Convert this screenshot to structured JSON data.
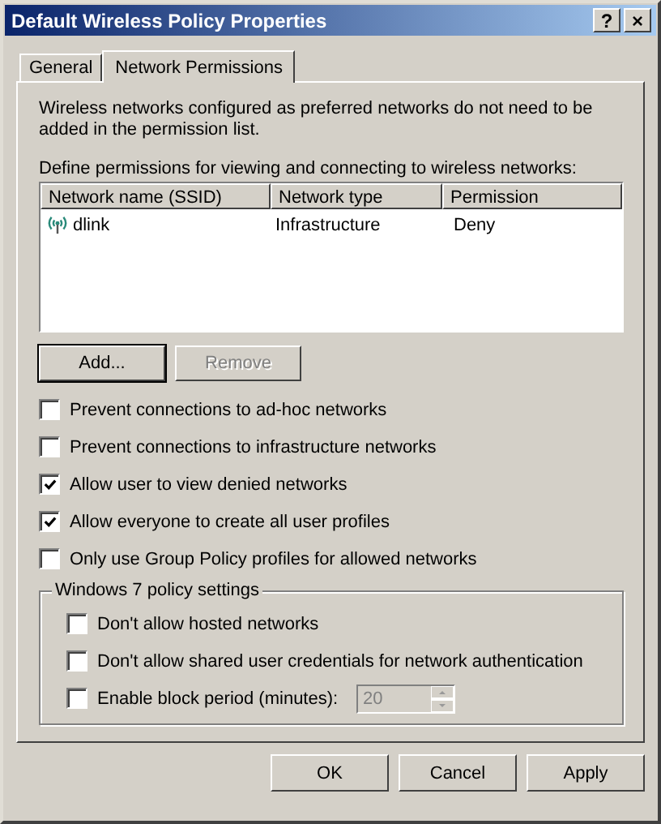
{
  "window": {
    "title": "Default Wireless Policy Properties",
    "help_button": "?",
    "close_button": "×"
  },
  "tabs": [
    {
      "label": "General",
      "selected": false
    },
    {
      "label": "Network Permissions",
      "selected": true
    }
  ],
  "description": "Wireless networks configured as preferred networks do not need to be added in the permission list.",
  "list_label": "Define permissions for viewing and connecting to wireless networks:",
  "table": {
    "columns": [
      "Network name (SSID)",
      "Network type",
      "Permission"
    ],
    "rows": [
      {
        "cells": [
          "dlink",
          "Infrastructure",
          "Deny"
        ]
      }
    ]
  },
  "list_buttons": [
    {
      "label": "Add...",
      "disabled": false
    },
    {
      "label": "Remove",
      "disabled": true
    }
  ],
  "options": [
    {
      "label": "Prevent connections to ad-hoc networks",
      "checked": false
    },
    {
      "label": "Prevent connections to infrastructure networks",
      "checked": false
    },
    {
      "label": "Allow user to view denied networks",
      "checked": true
    },
    {
      "label": "Allow everyone to create all user profiles",
      "checked": true
    },
    {
      "label": "Only use Group Policy profiles for allowed networks",
      "checked": false
    }
  ],
  "group": {
    "title": "Windows 7 policy settings",
    "options": [
      {
        "label": "Don't allow hosted networks",
        "checked": false
      },
      {
        "label": "Don't allow shared user credentials for network authentication",
        "checked": false
      }
    ],
    "block_period": {
      "label": "Enable block period (minutes):",
      "checked": false,
      "value": "20",
      "disabled": true
    }
  },
  "footer_buttons": [
    {
      "label": "OK",
      "disabled": false
    },
    {
      "label": "Cancel",
      "disabled": false
    },
    {
      "label": "Apply",
      "disabled": false
    }
  ]
}
